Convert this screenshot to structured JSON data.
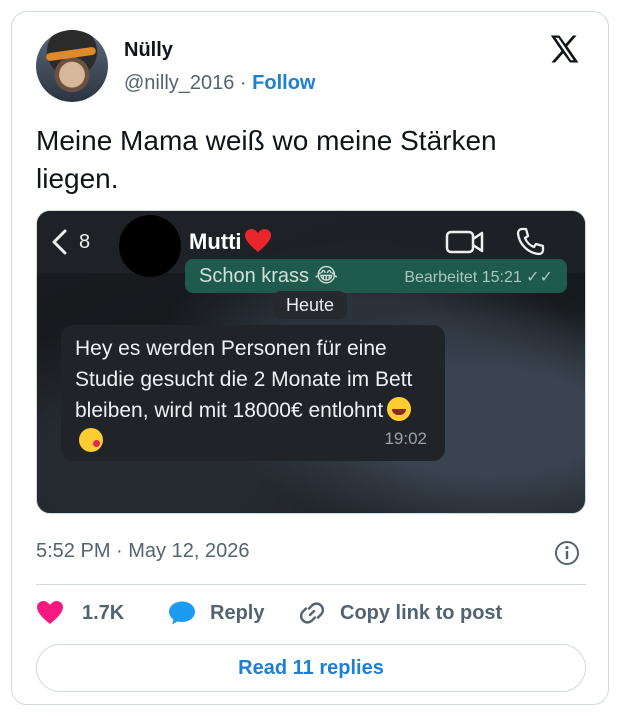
{
  "author": {
    "display_name": "Nülly",
    "handle": "@nilly_2016",
    "separator": " · ",
    "follow_label": "Follow"
  },
  "tweet": {
    "text": "Meine Mama weiß wo meine Stärken liegen."
  },
  "media": {
    "chat_header": {
      "back_count": "8",
      "contact_name": "Mutti"
    },
    "sent_message": {
      "text": "Schon krass 😂",
      "meta": "Bearbeitet 15:21 ✓✓"
    },
    "day_label": "Heute",
    "received_message": {
      "text": "Hey es werden Personen für eine Studie gesucht die 2 Monate im Bett bleiben, wird mit 18000€ entlohnt",
      "time": "19:02"
    }
  },
  "footer": {
    "timestamp": "5:52 PM · May 12, 2026",
    "likes": "1.7K",
    "reply_label": "Reply",
    "copy_label": "Copy link to post",
    "read_replies_label": "Read 11 replies"
  },
  "colors": {
    "accent": "#1d7fd6",
    "like": "#f91880",
    "reply_icon": "#1d9bf0",
    "muted": "#536471"
  }
}
